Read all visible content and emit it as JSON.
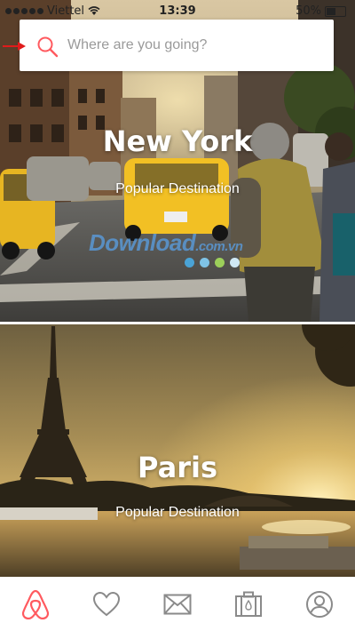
{
  "status_bar": {
    "carrier": "Viettel",
    "time": "13:39",
    "battery": "50%"
  },
  "search": {
    "placeholder": "Where are you going?"
  },
  "destinations": [
    {
      "title": "New York",
      "subtitle": "Popular Destination"
    },
    {
      "title": "Paris",
      "subtitle": "Popular Destination"
    }
  ],
  "watermark": {
    "text": "Download",
    "suffix": ".com.vn"
  },
  "colors": {
    "accent": "#ff5a5f",
    "icon_gray": "#8a8a8a",
    "placeholder": "#9a9a9a"
  },
  "tab_bar": [
    {
      "icon": "airbnb-logo-icon",
      "active": true
    },
    {
      "icon": "heart-icon",
      "active": false
    },
    {
      "icon": "envelope-icon",
      "active": false
    },
    {
      "icon": "suitcase-icon",
      "active": false
    },
    {
      "icon": "profile-icon",
      "active": false
    }
  ]
}
